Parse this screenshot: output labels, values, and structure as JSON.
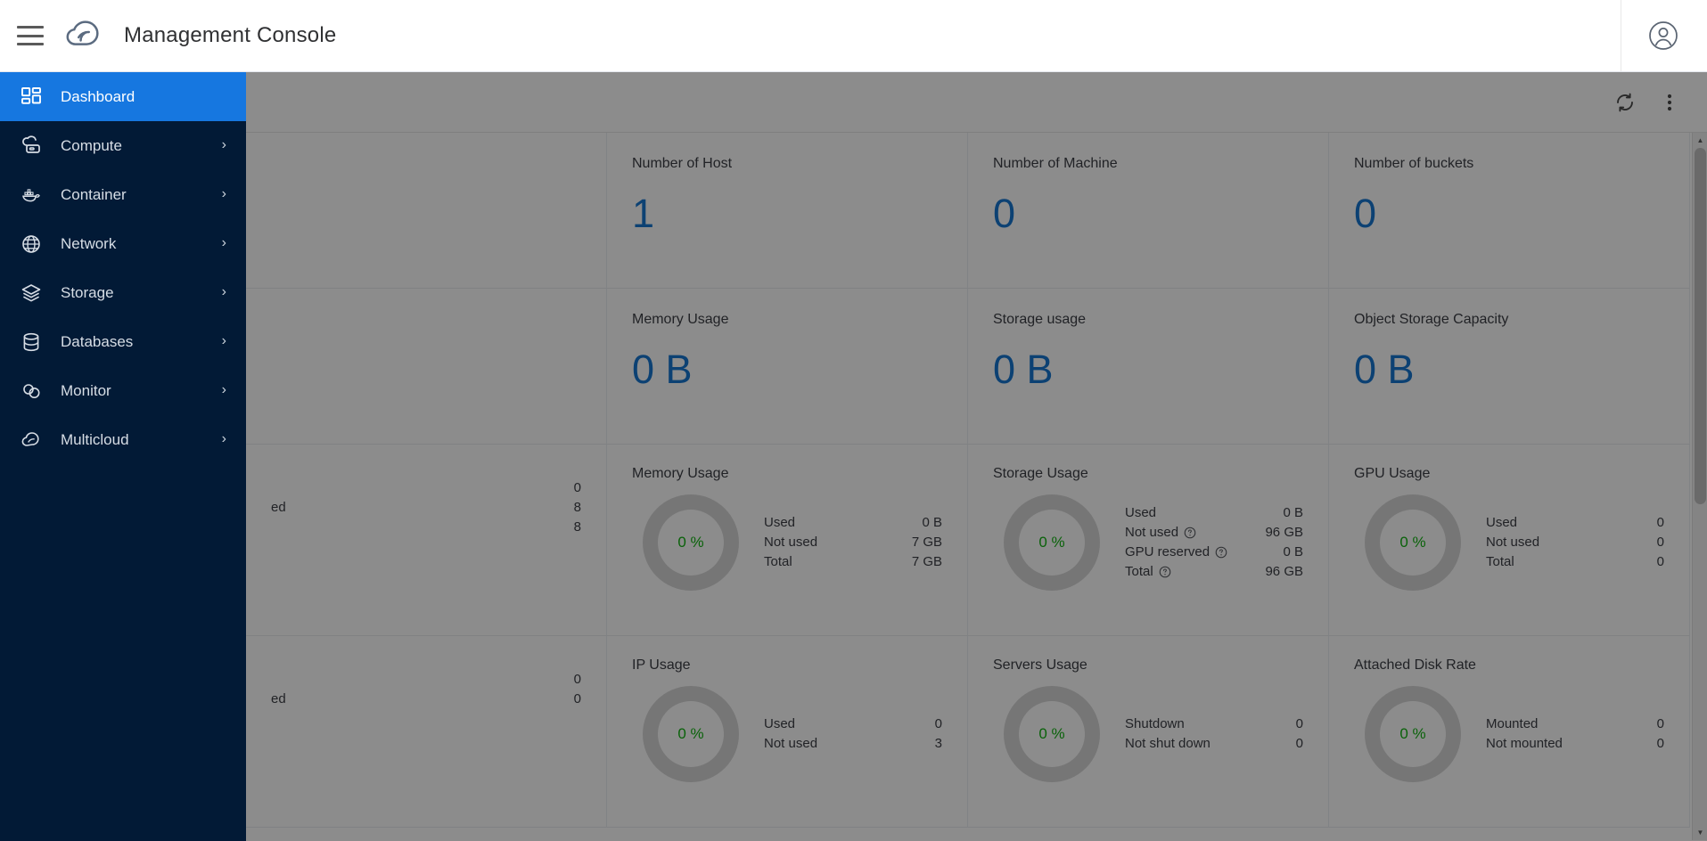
{
  "header": {
    "title": "Management Console",
    "menu_icon": "hamburger-icon",
    "logo_icon": "cloud-logo-icon",
    "avatar_icon": "user-avatar-icon"
  },
  "sidebar": {
    "items": [
      {
        "label": "Dashboard",
        "icon": "dashboard-grid-icon",
        "active": true,
        "chevron": ""
      },
      {
        "label": "Compute",
        "icon": "server-cloud-icon",
        "active": false,
        "chevron": "›"
      },
      {
        "label": "Container",
        "icon": "docker-whale-icon",
        "active": false,
        "chevron": "›"
      },
      {
        "label": "Network",
        "icon": "globe-icon",
        "active": false,
        "chevron": "›"
      },
      {
        "label": "Storage",
        "icon": "layers-icon",
        "active": false,
        "chevron": "›"
      },
      {
        "label": "Databases",
        "icon": "database-icon",
        "active": false,
        "chevron": "›"
      },
      {
        "label": "Monitor",
        "icon": "monitor-cloud-icon",
        "active": false,
        "chevron": "›"
      },
      {
        "label": "Multicloud",
        "icon": "multicloud-icon",
        "active": false,
        "chevron": "›"
      }
    ]
  },
  "toolbar": {
    "refresh_icon": "refresh-icon",
    "more_icon": "more-vertical-icon"
  },
  "colors": {
    "accent_blue": "#1677e0",
    "value_blue": "#1677d2",
    "percent_green": "#12b312",
    "sidebar_bg": "#021a36"
  },
  "counter_cards": [
    {
      "title": "",
      "value": ""
    },
    {
      "title": "Number of Host",
      "value": "1"
    },
    {
      "title": "Number of Machine",
      "value": "0"
    },
    {
      "title": "Number of buckets",
      "value": "0"
    },
    {
      "title": "",
      "value": ""
    },
    {
      "title": "Memory Usage",
      "value": "0 B"
    },
    {
      "title": "Storage usage",
      "value": "0 B"
    },
    {
      "title": "Object Storage Capacity",
      "value": "0 B"
    }
  ],
  "donut_cards": [
    {
      "title": "",
      "percent": "",
      "hidden": true,
      "stats": [
        {
          "label": "",
          "value": "0",
          "help": false
        },
        {
          "label": "ed",
          "value": "8",
          "help": false
        },
        {
          "label": "",
          "value": "8",
          "help": false
        }
      ]
    },
    {
      "title": "Memory Usage",
      "percent": "0 %",
      "hidden": false,
      "stats": [
        {
          "label": "Used",
          "value": "0 B",
          "help": false
        },
        {
          "label": "Not used",
          "value": "7 GB",
          "help": false
        },
        {
          "label": "Total",
          "value": "7 GB",
          "help": false
        }
      ]
    },
    {
      "title": "Storage Usage",
      "percent": "0 %",
      "hidden": false,
      "stats": [
        {
          "label": "Used",
          "value": "0 B",
          "help": false
        },
        {
          "label": "Not used",
          "value": "96 GB",
          "help": true
        },
        {
          "label": "GPU reserved",
          "value": "0 B",
          "help": true
        },
        {
          "label": "Total",
          "value": "96 GB",
          "help": true
        }
      ]
    },
    {
      "title": "GPU Usage",
      "percent": "0 %",
      "hidden": false,
      "stats": [
        {
          "label": "Used",
          "value": "0",
          "help": false
        },
        {
          "label": "Not used",
          "value": "0",
          "help": false
        },
        {
          "label": "Total",
          "value": "0",
          "help": false
        }
      ]
    },
    {
      "title": "",
      "percent": "",
      "hidden": true,
      "stats": [
        {
          "label": "",
          "value": "0",
          "help": false
        },
        {
          "label": "ed",
          "value": "0",
          "help": false
        }
      ]
    },
    {
      "title": "IP Usage",
      "percent": "0 %",
      "hidden": false,
      "stats": [
        {
          "label": "Used",
          "value": "0",
          "help": false
        },
        {
          "label": "Not used",
          "value": "3",
          "help": false
        }
      ]
    },
    {
      "title": "Servers Usage",
      "percent": "0 %",
      "hidden": false,
      "stats": [
        {
          "label": "Shutdown",
          "value": "0",
          "help": false
        },
        {
          "label": "Not shut down",
          "value": "0",
          "help": false
        }
      ]
    },
    {
      "title": "Attached Disk Rate",
      "percent": "0 %",
      "hidden": false,
      "stats": [
        {
          "label": "Mounted",
          "value": "0",
          "help": false
        },
        {
          "label": "Not mounted",
          "value": "0",
          "help": false
        }
      ]
    }
  ],
  "scrollbar": {
    "up_arrow": "▲",
    "down_arrow": "▼"
  }
}
